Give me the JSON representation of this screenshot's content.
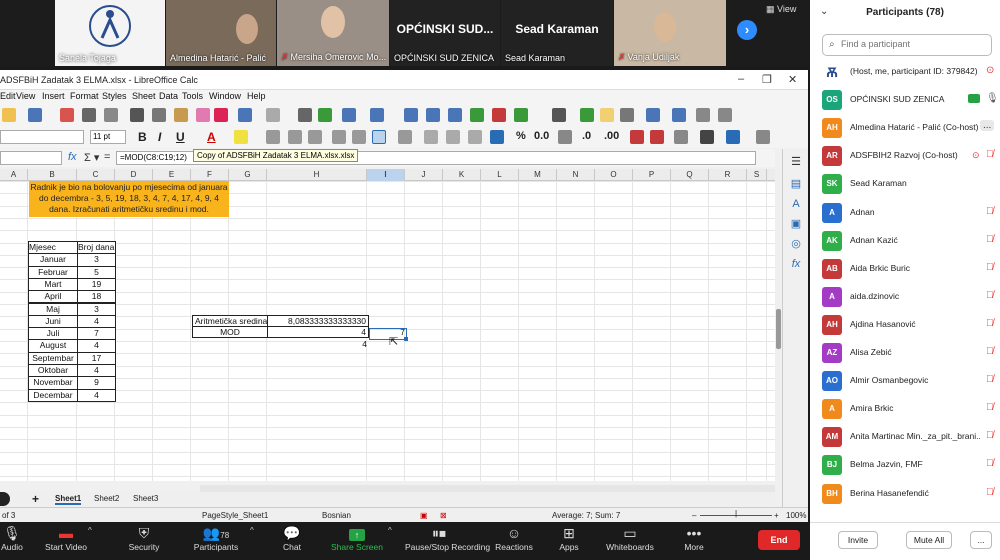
{
  "video_strip": {
    "tiles": [
      {
        "name": "Sanela Tojaga",
        "muted": false
      },
      {
        "name": "Almedina Hatarić - Palić",
        "muted": false
      },
      {
        "name": "Mersiha Omerovic Mo...",
        "muted": true
      },
      {
        "name": "OPĆINSKI SUD ZENICA",
        "muted": false,
        "big_text": "OPĆINSKI SUD..."
      },
      {
        "name": "Sead Karaman",
        "muted": false,
        "big_text": "Sead Karaman"
      },
      {
        "name": "Vanja Udiljak",
        "muted": true
      }
    ],
    "view_label": "View"
  },
  "calc": {
    "title": "ADSFBiH Zadatak 3 ELMA.xlsx - LibreOffice Calc",
    "menu": [
      "Edit",
      "View",
      "Insert",
      "Format",
      "Styles",
      "Sheet",
      "Data",
      "Tools",
      "Window",
      "Help"
    ],
    "font_size": "11 pt",
    "formula": "=MOD(C8:C19;12)",
    "tooltip": "Copy of ADSFBiH Zadatak 3 ELMA.xlsx.xlsx",
    "columns": [
      "A",
      "B",
      "C",
      "D",
      "E",
      "F",
      "G",
      "H",
      "I",
      "J",
      "K",
      "L",
      "M",
      "N",
      "O",
      "P",
      "Q",
      "R",
      "S"
    ],
    "selected_column": "I",
    "note_text": "Radnik je bio na bolovanju po mjesecima od januara do decembra - 3, 5, 19, 18, 3, 4, 7, 4, 17, 4, 9, 4 dana. Izračunati aritmetičku sredinu i mod.",
    "table_headers": [
      "Mjesec",
      "Broj dana"
    ],
    "table_rows": [
      [
        "Januar",
        "3"
      ],
      [
        "Februar",
        "5"
      ],
      [
        "Mart",
        "19"
      ],
      [
        "April",
        "18"
      ],
      [
        "Maj",
        "3"
      ],
      [
        "Juni",
        "4"
      ],
      [
        "Juli",
        "7"
      ],
      [
        "August",
        "4"
      ],
      [
        "Septembar",
        "17"
      ],
      [
        "Oktobar",
        "4"
      ],
      [
        "Novembar",
        "9"
      ],
      [
        "Decembar",
        "4"
      ]
    ],
    "stats": {
      "mean_label": "Aritmetička sredina",
      "mean_value": "8,083333333333330",
      "mode_label": "MOD",
      "mode_value": "4",
      "extra_value": "4",
      "selected_value": "7"
    },
    "sheets": [
      "Sheet1",
      "Sheet2",
      "Sheet3"
    ],
    "active_sheet": "Sheet1",
    "status": {
      "page": "of 3",
      "page_style": "PageStyle_Sheet1",
      "language": "Bosnian",
      "summary": "Average: 7; Sum: 7",
      "zoom": "100%"
    }
  },
  "zoom_toolbar": {
    "buttons": [
      {
        "label": "Audio"
      },
      {
        "label": "Start Video"
      },
      {
        "label": "Security"
      },
      {
        "label": "Participants",
        "count": "78"
      },
      {
        "label": "Chat"
      },
      {
        "label": "Share Screen"
      },
      {
        "label": "Pause/Stop Recording"
      },
      {
        "label": "Reactions"
      },
      {
        "label": "Apps"
      },
      {
        "label": "Whiteboards"
      },
      {
        "label": "More"
      }
    ],
    "end_label": "End"
  },
  "participants": {
    "title": "Participants (78)",
    "search_placeholder": "Find a participant",
    "list": [
      {
        "initials": "",
        "name": "(Host, me, participant ID: 379842)",
        "color": "#ffffff"
      },
      {
        "initials": "OS",
        "name": "OPĆINSKI SUD ZENICA",
        "color": "#1aa57a"
      },
      {
        "initials": "AH",
        "name": "Almedina Hatarić - Palić (Co-host)",
        "color": "#f08a1d"
      },
      {
        "initials": "AR",
        "name": "ADSFBIH2 Razvoj (Co-host)",
        "color": "#c43a3a"
      },
      {
        "initials": "SK",
        "name": "Sead Karaman",
        "color": "#2fae4a"
      },
      {
        "initials": "A",
        "name": "Adnan",
        "color": "#2a6fd0"
      },
      {
        "initials": "AK",
        "name": "Adnan Kazić",
        "color": "#2fae4a"
      },
      {
        "initials": "AB",
        "name": "Aida Brkic Buric",
        "color": "#c43a3a"
      },
      {
        "initials": "A",
        "name": "aida.dzinovic",
        "color": "#a33bc4"
      },
      {
        "initials": "AH",
        "name": "Ajdina Hasanović",
        "color": "#c43a3a"
      },
      {
        "initials": "AZ",
        "name": "Alisa Zebić",
        "color": "#a33bc4"
      },
      {
        "initials": "AO",
        "name": "Almir Osmanbegovic",
        "color": "#2a6fd0"
      },
      {
        "initials": "A",
        "name": "Amira Brkic",
        "color": "#f08a1d"
      },
      {
        "initials": "AM",
        "name": "Anita Martinac Min._za_pit._brani...",
        "color": "#c43a3a"
      },
      {
        "initials": "BJ",
        "name": "Belma Jazvin, FMF",
        "color": "#2fae4a"
      },
      {
        "initials": "BH",
        "name": "Berina Hasanefendić",
        "color": "#f08a1d"
      }
    ],
    "invite_label": "Invite",
    "mute_all_label": "Mute All",
    "more_label": "..."
  }
}
